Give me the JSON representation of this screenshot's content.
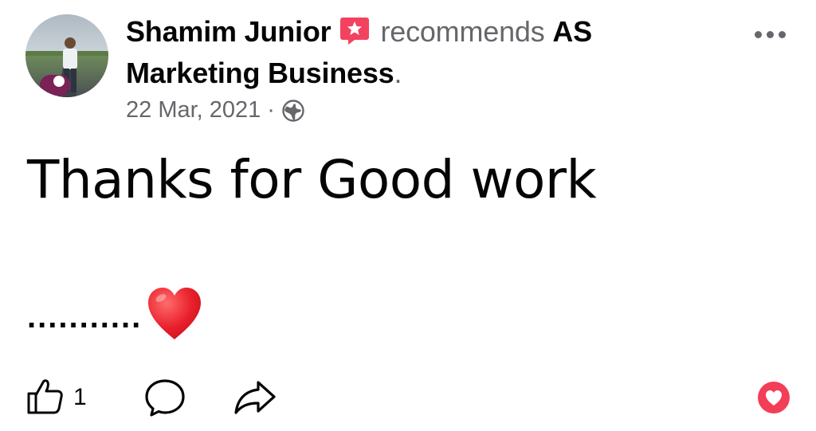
{
  "post": {
    "author": "Shamim Junior",
    "verb": "recommends",
    "page_name": "AS Marketing Business",
    "period": ".",
    "date": "22 Mar, 2021",
    "separator": "·",
    "audience_icon": "globe-icon",
    "text_line1": "Thanks for Good work",
    "text_line2": "...........",
    "emoji": "red-heart",
    "more_icon": "more-horizontal-icon"
  },
  "actions": {
    "like_count": "1",
    "like_icon": "thumbs-up-outline-icon",
    "comment_icon": "comment-bubble-icon",
    "share_icon": "share-arrow-icon",
    "reaction_icon": "heart-reaction-icon"
  },
  "colors": {
    "text": "#050505",
    "secondary": "#65676b",
    "recommend_badge": "#f3425f",
    "reaction": "#f33e58"
  }
}
